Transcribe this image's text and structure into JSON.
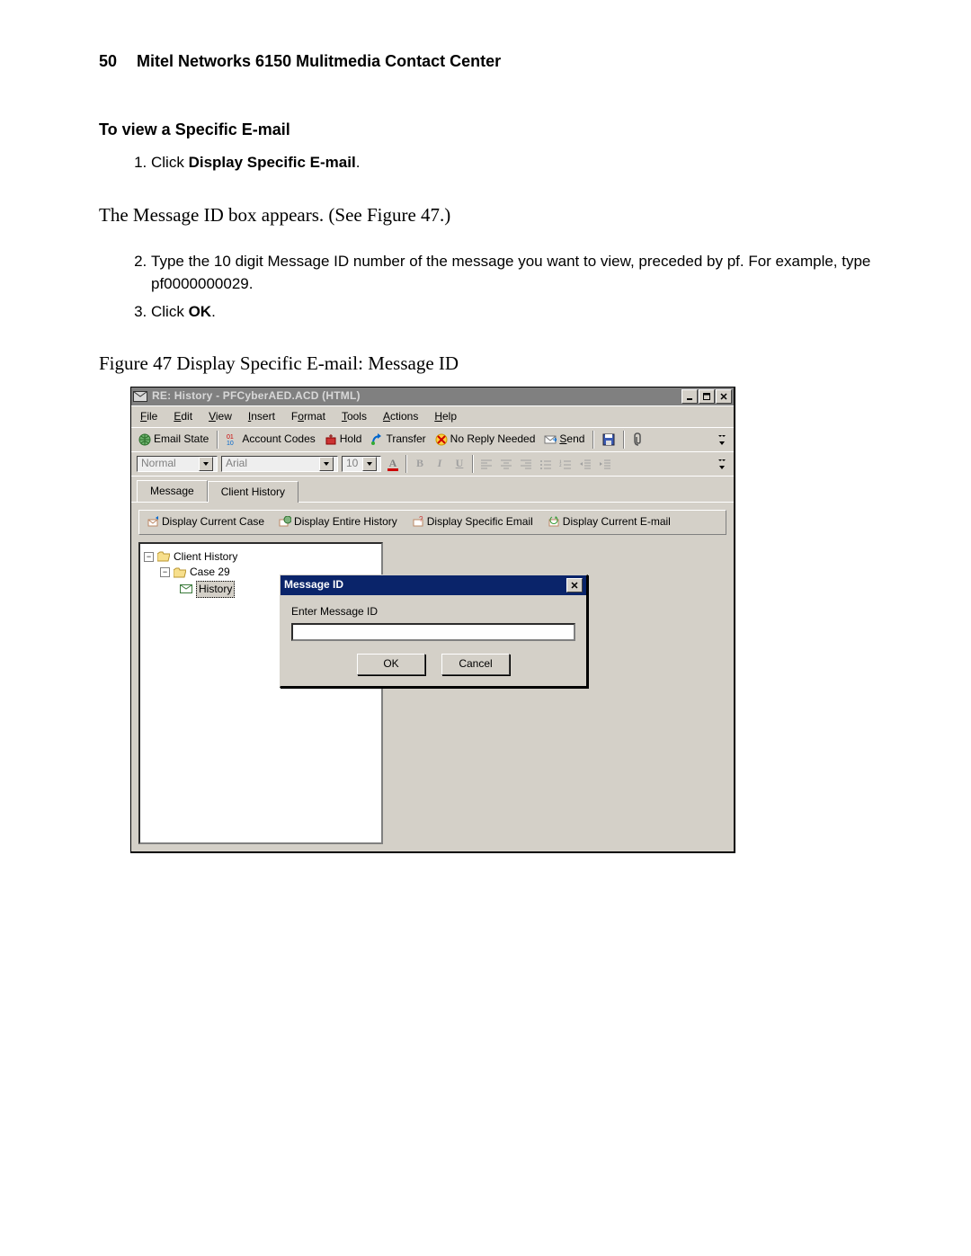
{
  "page_header": {
    "number": "50",
    "title": "Mitel Networks 6150 Mulitmedia Contact Center"
  },
  "section_title": "To view a Specific E-mail",
  "step1_prefix": "Click ",
  "step1_bold": "Display Specific E-mail",
  "step1_suffix": ".",
  "paragraph1": "The Message ID box appears. (See Figure 47.)",
  "step2": "Type the 10 digit Message ID number of the message you want to view, preceded by pf. For example, type pf0000000029.",
  "step3_prefix": "Click ",
  "step3_bold": "OK",
  "step3_suffix": ".",
  "figure_caption": "Figure 47  Display Specific E-mail: Message ID",
  "window": {
    "title": "RE: History - PFCyberAED.ACD  (HTML)",
    "menus": {
      "file": "File",
      "edit": "Edit",
      "view": "View",
      "insert": "Insert",
      "format": "Format",
      "tools": "Tools",
      "actions": "Actions",
      "help": "Help"
    },
    "toolbar1": {
      "email_state": "Email State",
      "account_codes": "Account Codes",
      "hold": "Hold",
      "transfer": "Transfer",
      "no_reply": "No Reply Needed",
      "send": "Send"
    },
    "format_bar": {
      "style": "Normal",
      "font": "Arial",
      "size": "10"
    },
    "tabs": {
      "message": "Message",
      "client_history": "Client History"
    },
    "history_bar": {
      "display_current_case": "Display Current Case",
      "display_entire_history": "Display Entire History",
      "display_specific_email": "Display Specific Email",
      "display_current_email": "Display Current E-mail"
    },
    "tree": {
      "root": "Client History",
      "case": "Case 29",
      "history": "History"
    }
  },
  "dialog": {
    "title": "Message ID",
    "label": "Enter Message ID",
    "input_value": "",
    "ok": "OK",
    "cancel": "Cancel"
  }
}
